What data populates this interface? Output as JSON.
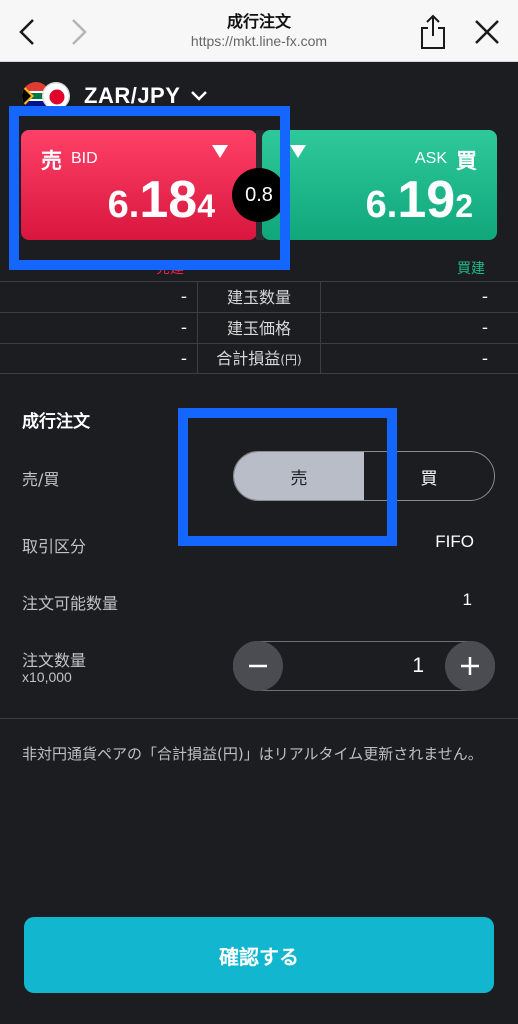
{
  "browser": {
    "title": "成行注文",
    "url": "https://mkt.line-fx.com",
    "back_icon": "chevron-left",
    "forward_icon": "chevron-right",
    "share_icon": "share",
    "close_icon": "close"
  },
  "pair": {
    "name": "ZAR/JPY",
    "flags": [
      "south-africa-flag",
      "japan-flag"
    ]
  },
  "bid": {
    "kana": "売",
    "side": "BID",
    "price_head": "6.",
    "price_big": "18",
    "price_pip": "4",
    "color": "#e8244d"
  },
  "ask": {
    "kana": "買",
    "side": "ASK",
    "price_head": "6.",
    "price_big": "19",
    "price_pip": "2",
    "color": "#1fb88b"
  },
  "spread": "0.8",
  "labels": {
    "sell_position": "売建",
    "buy_position": "買建"
  },
  "position_table": [
    {
      "left": "-",
      "label": "建玉数量",
      "unit": "",
      "right": "-"
    },
    {
      "left": "-",
      "label": "建玉価格",
      "unit": "",
      "right": "-"
    },
    {
      "left": "-",
      "label": "合計損益",
      "unit": "(円)",
      "right": "-"
    }
  ],
  "form": {
    "title": "成行注文",
    "side_label": "売/買",
    "sell_option": "売",
    "buy_option": "買",
    "selected": "売",
    "trade_type_label": "取引区分",
    "trade_type_value": "FIFO",
    "available_label": "注文可能数量",
    "available_value": "1",
    "quantity_label": "注文数量",
    "quantity_unit": "x10,000",
    "quantity_value": "1"
  },
  "note": "非対円通貨ペアの「合計損益(円)」はリアルタイム更新されません。",
  "confirm_label": "確認する",
  "accent": "#1565ff"
}
